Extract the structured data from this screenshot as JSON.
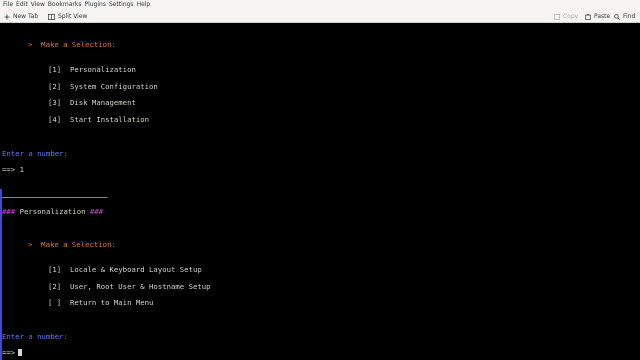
{
  "menubar": {
    "items": [
      "File",
      "Edit",
      "View",
      "Bookmarks",
      "Plugins",
      "Settings",
      "Help"
    ]
  },
  "toolbar": {
    "new_tab": "New Tab",
    "split_view": "Split View",
    "copy": "Copy",
    "paste": "Paste",
    "find": "Find"
  },
  "terminal": {
    "menu1": {
      "prompt": ">  Make a Selection:",
      "options": [
        "[1]  Personalization",
        "[2]  System Configuration",
        "[3]  Disk Management",
        "[4]  Start Installation"
      ],
      "enter": "Enter a number:",
      "input": "==> 1"
    },
    "separator": "────────────────────────",
    "heading_marker_left": "###",
    "heading_title": " Personalization ",
    "heading_marker_right": "###",
    "menu2": {
      "prompt": ">  Make a Selection:",
      "options": [
        "[1]  Locale & Keyboard Layout Setup",
        "[2]  User, Root User & Hostname Setup",
        "[ ]  Return to Main Menu"
      ],
      "enter": "Enter a number:",
      "input": "==> "
    }
  },
  "colors": {
    "prompt": "#e07a1f",
    "text": "#d3d7cf",
    "input_label": "#5c7cff",
    "heading_marker": "#c84ac8",
    "gutter": "#3b4bd8"
  }
}
